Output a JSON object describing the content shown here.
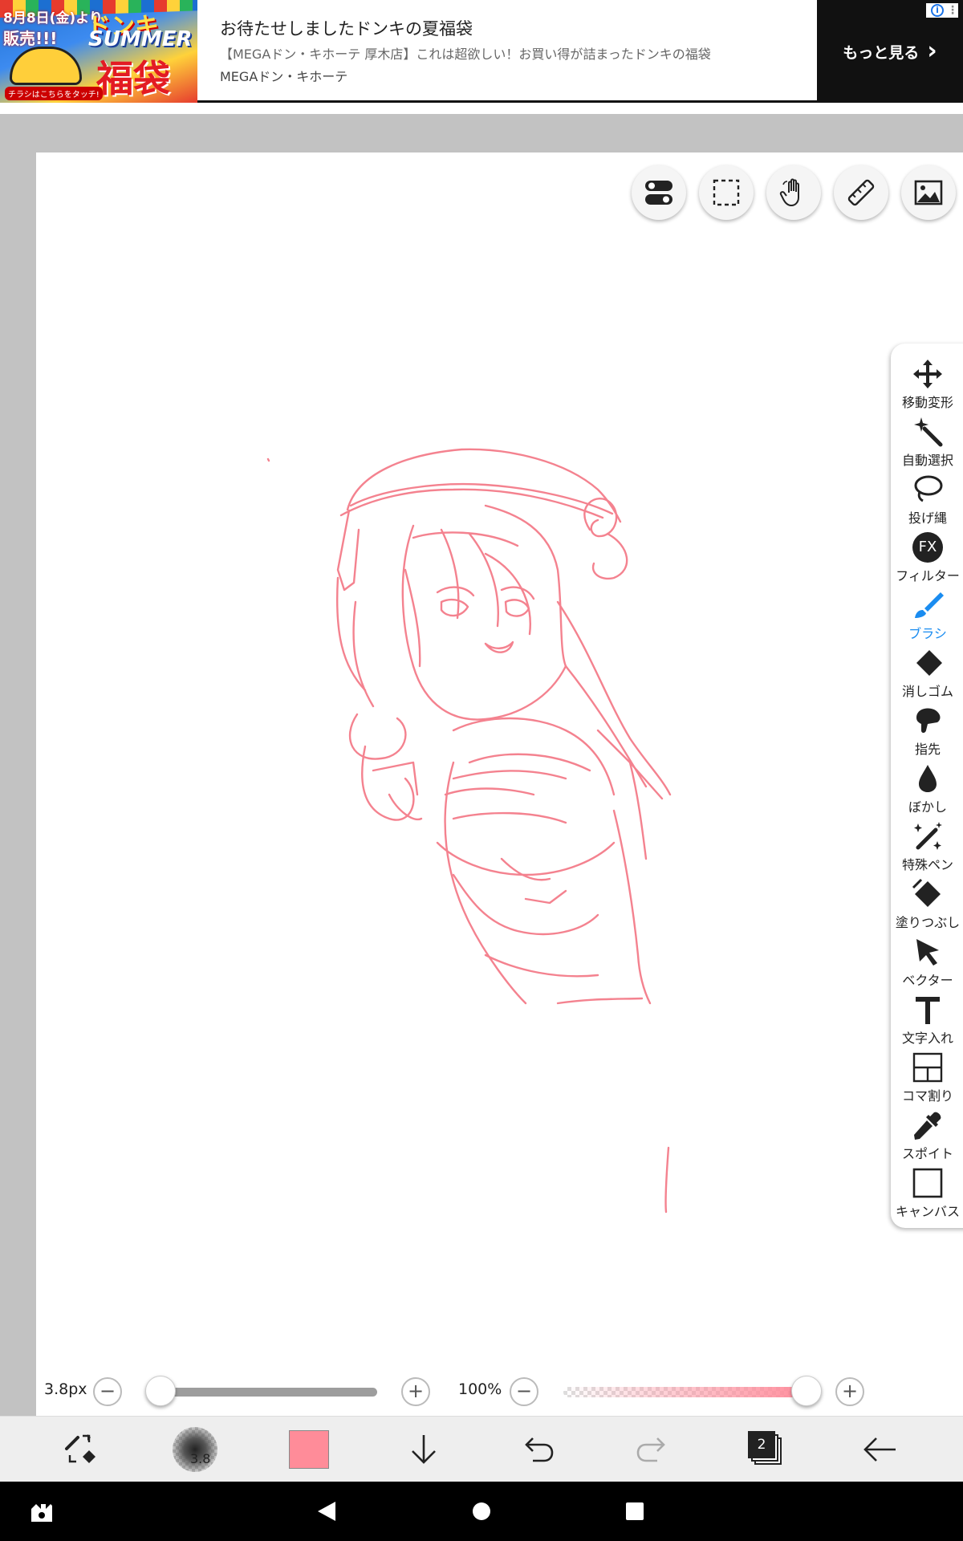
{
  "ad": {
    "image_text": {
      "date": "8月8日(金)より",
      "sale": "販売!!!",
      "brand": "ドンキ",
      "summer": "SUMMER",
      "fukubukuro": "福袋",
      "flyer": "チラシはこちらをタッチ!"
    },
    "title": "お待たせしましたドンキの夏福袋",
    "description": "【MEGAドン・キホーテ 厚木店】これは超欲しい！お買い得が詰まったドンキの福袋",
    "brand": "MEGAドン・キホーテ",
    "more_label": "もっと見る",
    "more_chevron": "›",
    "info_icon": "i",
    "menu_dots": "⋮"
  },
  "top_tools": [
    {
      "name": "toggle-icon"
    },
    {
      "name": "selection-icon"
    },
    {
      "name": "hand-icon"
    },
    {
      "name": "ruler-icon"
    },
    {
      "name": "image-icon"
    }
  ],
  "tools": {
    "move": "移動変形",
    "magic_wand": "自動選択",
    "lasso": "投げ縄",
    "filter": "フィルター",
    "filter_icon_text": "FX",
    "brush": "ブラシ",
    "eraser": "消しゴム",
    "smudge": "指先",
    "blur": "ぼかし",
    "special_pen": "特殊ペン",
    "fill": "塗りつぶし",
    "vector": "ベクター",
    "text": "文字入れ",
    "frame": "コマ割り",
    "eyedropper": "スポイト",
    "canvas": "キャンバス"
  },
  "brush_size": {
    "label": "3.8px",
    "value": 3.8,
    "minus": "−",
    "plus": "+",
    "fraction": 0.0
  },
  "opacity": {
    "label": "100%",
    "value": 100,
    "minus": "−",
    "plus": "+"
  },
  "bottom": {
    "brush_preview_size": "3.8",
    "color": "#ff8c99",
    "layer_count": "2"
  },
  "colors": {
    "accent": "#1a8cf0",
    "stroke": "#f4828f",
    "ad_more_bg": "#111111"
  }
}
